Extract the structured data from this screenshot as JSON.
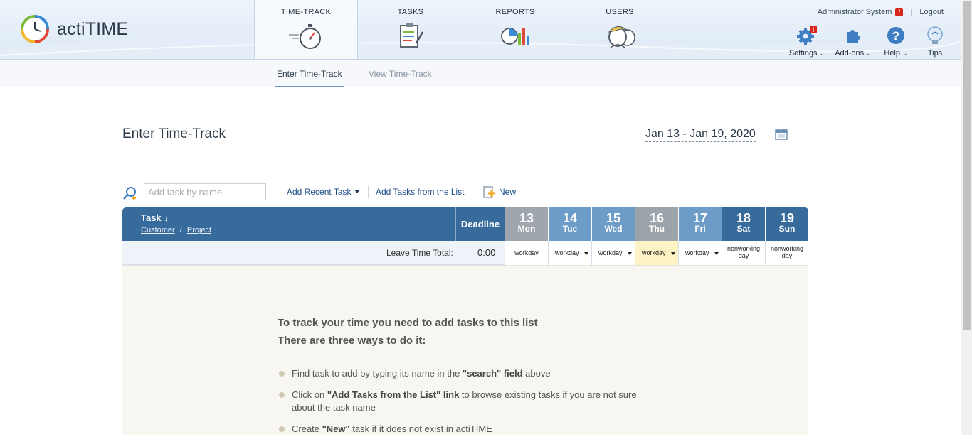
{
  "app": {
    "name": "actiTIME"
  },
  "nav": {
    "tabs": [
      {
        "label": "TIME-TRACK",
        "icon": "stopwatch-icon",
        "active": true
      },
      {
        "label": "TASKS",
        "icon": "task-clipboard-icon",
        "active": false
      },
      {
        "label": "REPORTS",
        "icon": "reports-chart-icon",
        "active": false
      },
      {
        "label": "USERS",
        "icon": "users-avatar-icon",
        "active": false
      }
    ]
  },
  "header": {
    "user_name": "Administrator System",
    "alert_mark": "!",
    "logout_label": "Logout",
    "tools": [
      {
        "label": "Settings",
        "icon": "gear-icon",
        "has_dropdown": true,
        "badge": "!"
      },
      {
        "label": "Add-ons",
        "icon": "puzzle-icon",
        "has_dropdown": true
      },
      {
        "label": "Help",
        "icon": "help-icon",
        "has_dropdown": true
      },
      {
        "label": "Tips",
        "icon": "lightbulb-icon",
        "has_dropdown": false
      }
    ],
    "dropdown_glyph": "⌄"
  },
  "subnav": {
    "tabs": [
      {
        "label": "Enter Time-Track",
        "active": true
      },
      {
        "label": "View Time-Track",
        "active": false
      }
    ]
  },
  "main": {
    "title": "Enter Time-Track",
    "date_range": "Jan 13 - Jan 19, 2020",
    "search": {
      "placeholder": "Add task by name",
      "value": ""
    },
    "actions": {
      "recent": "Add Recent Task",
      "from_list": "Add Tasks from the List",
      "new": "New"
    }
  },
  "grid": {
    "task_header": "Task",
    "sort_arrow": "↓",
    "customer_label": "Customer",
    "path_sep": "/",
    "project_label": "Project",
    "deadline_header": "Deadline",
    "days": [
      {
        "num": "13",
        "name": "Mon",
        "kind": "past",
        "status": "workday",
        "dropdown": false,
        "highlight": false
      },
      {
        "num": "14",
        "name": "Tue",
        "kind": "weekday",
        "status": "workday",
        "dropdown": true,
        "highlight": false
      },
      {
        "num": "15",
        "name": "Wed",
        "kind": "weekday",
        "status": "workday",
        "dropdown": true,
        "highlight": false
      },
      {
        "num": "16",
        "name": "Thu",
        "kind": "today",
        "status": "workday",
        "dropdown": true,
        "highlight": true
      },
      {
        "num": "17",
        "name": "Fri",
        "kind": "weekday",
        "status": "workday",
        "dropdown": true,
        "highlight": false
      },
      {
        "num": "18",
        "name": "Sat",
        "kind": "weekend",
        "status_line1": "nonworking",
        "status_line2": "day",
        "dropdown": false,
        "highlight": false
      },
      {
        "num": "19",
        "name": "Sun",
        "kind": "weekend",
        "status_line1": "nonworking",
        "status_line2": "day",
        "dropdown": false,
        "highlight": false
      }
    ],
    "leave_label": "Leave Time Total:",
    "leave_value": "0:00"
  },
  "help": {
    "heading1": "To track your time you need to add tasks to this list",
    "heading2": "There are three ways to do it:",
    "items": [
      {
        "pre": "Find task to add by typing its name in the ",
        "bold": "\"search\" field",
        "post": " above"
      },
      {
        "pre": "Click on ",
        "bold": "\"Add Tasks from the List\" link",
        "post": " to browse existing tasks if you are not sure about the task name"
      },
      {
        "pre": "Create ",
        "bold": "\"New\"",
        "post": " task if it does not exist in actiTIME"
      }
    ]
  },
  "colors": {
    "grid_header": "#376b9c",
    "weekday_header": "#6d9cc8",
    "today_highlight": "#fdf3c4",
    "link": "#1f4f86",
    "alert": "#d9261c"
  }
}
